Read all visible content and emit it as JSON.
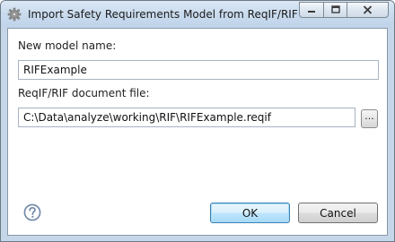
{
  "window": {
    "title": "Import Safety Requirements Model from ReqIF/RIF"
  },
  "form": {
    "model_name_label": "New model name:",
    "model_name_value": "RIFExample",
    "doc_file_label": "ReqIF/RIF document file:",
    "doc_file_value": "C:\\Data\\analyze\\working\\RIF\\RIFExample.reqif",
    "browse_label": "..."
  },
  "footer": {
    "help_icon": "help-icon",
    "ok_label": "OK",
    "cancel_label": "Cancel"
  },
  "colors": {
    "title_bar": "#c9dbee",
    "close_button": "#c75050",
    "ok_border": "#3c7fb1",
    "help_icon": "#6e86a6"
  }
}
